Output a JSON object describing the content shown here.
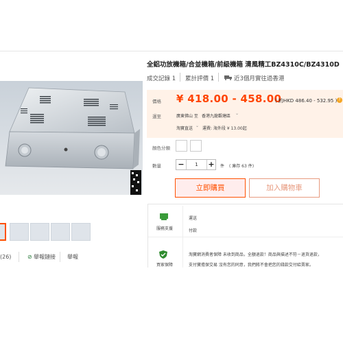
{
  "product": {
    "title": "全鋁功放機箱/合並機箱/前級機箱 清風精工BZ4310C/BZ4310D",
    "sales_label": "成交記錄 1",
    "reviews_label": "累計評價 1",
    "shipping_note": "近3個月實往過香港"
  },
  "price": {
    "label": "價格",
    "range": "¥ 418.00 - 458.00",
    "hkd": "( 約HKD 486.40 - 532.95 )"
  },
  "shipping": {
    "label": "運至",
    "origin": "廣東佛山 至",
    "destination": "香港九龍觀塘區",
    "carrier": "淘寶直送",
    "fee": "運費: 海外段 ¥ 13.00起"
  },
  "options": {
    "color_label": "顏色分類"
  },
  "quantity": {
    "label": "數量",
    "minus": "−",
    "value": "1",
    "plus": "+",
    "unit": "件",
    "stock": "( 庫存 63 件)"
  },
  "actions": {
    "buy": "立即購買",
    "cart": "加入購物車"
  },
  "share": {
    "count": "(26)",
    "report": "舉報鏈接",
    "extra": "舉報"
  },
  "service": {
    "support_label": "服務支援",
    "item1": "運送",
    "item2": "付款",
    "guarantee_label": "買家保障",
    "line1": "淘寶網消費者保障    未收到商品，全額退款！商品與描述不符－退貨退款，",
    "line2": "支付寶擔保交易         沒有您的同意，我們將不會把您的錢款交付給賣家。"
  },
  "colors": {
    "accent": "#ff5000",
    "price": "#ff4400",
    "price_bg": "#fff2e8"
  }
}
